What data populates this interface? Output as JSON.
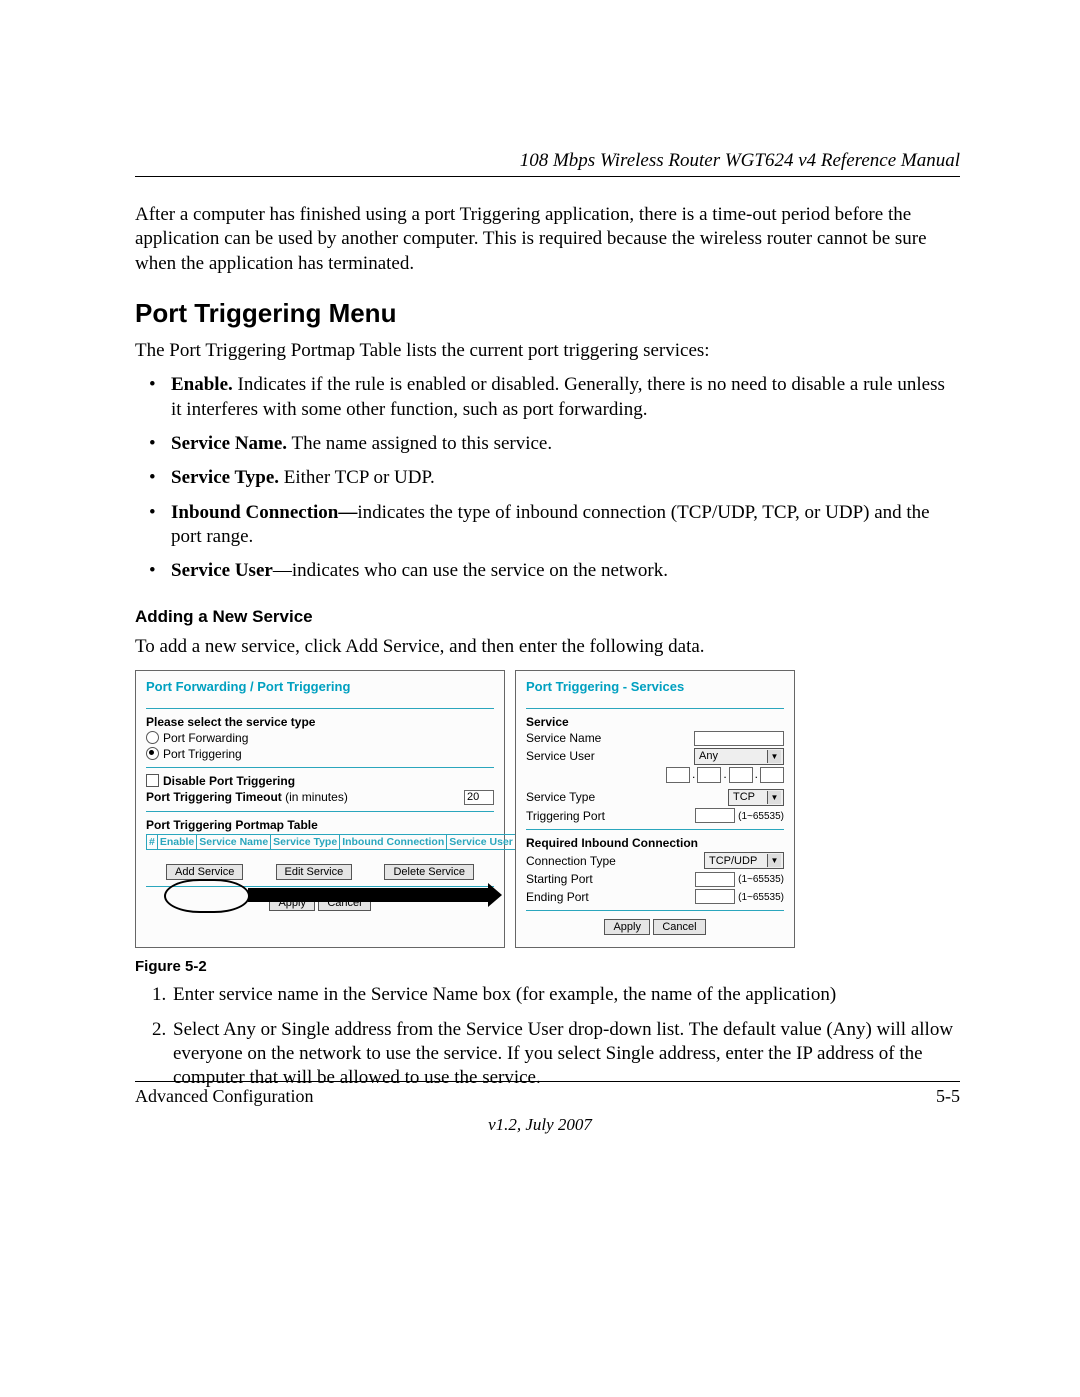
{
  "header": {
    "running_title": "108 Mbps Wireless Router WGT624 v4 Reference Manual"
  },
  "intro_paragraph": "After a computer has finished using a port Triggering application, there is a time-out period before the application can be used by another computer. This is required because the wireless router cannot be sure when the application has terminated.",
  "section": {
    "heading": "Port Triggering Menu",
    "intro": "The Port Triggering Portmap Table lists the current port triggering services:",
    "bullets": {
      "enable_strong": "Enable.",
      "enable_rest": " Indicates if the rule is enabled or disabled. Generally, there is no need to disable a rule unless it interferes with some other function, such as port forwarding.",
      "service_name_strong": "Service Name.",
      "service_name_rest": " The name assigned to this service.",
      "service_type_strong": "Service Type.",
      "service_type_rest": " Either TCP or UDP.",
      "inbound_strong": "Inbound Connection—",
      "inbound_rest": "indicates the type of inbound connection (TCP/UDP, TCP, or UDP) and the port range.",
      "service_user_strong": "Service User",
      "service_user_rest": "—indicates who can use the service on the network."
    }
  },
  "subsection": {
    "heading": "Adding a New Service",
    "intro": "To add a new service, click Add Service, and then enter the following data."
  },
  "left_panel": {
    "title": "Port Forwarding / Port Triggering",
    "select_label": "Please select the service type",
    "radio_forwarding": "Port Forwarding",
    "radio_triggering": "Port Triggering",
    "disable_label": "Disable Port Triggering",
    "timeout_label": "Port Triggering Timeout",
    "timeout_suffix": " (in minutes)",
    "timeout_value": "20",
    "portmap_heading": "Port Triggering Portmap Table",
    "cols": {
      "num": "#",
      "enable": "Enable",
      "sname": "Service Name",
      "stype": "Service Type",
      "inbound": "Inbound Connection",
      "suser": "Service User"
    },
    "btn_add": "Add Service",
    "btn_edit": "Edit Service",
    "btn_delete": "Delete Service",
    "btn_apply": "Apply",
    "btn_cancel": "Cancel"
  },
  "right_panel": {
    "title": "Port Triggering - Services",
    "service_heading": "Service",
    "service_name_label": "Service Name",
    "service_user_label": "Service User",
    "service_user_value": "Any",
    "service_type_label": "Service Type",
    "service_type_value": "TCP",
    "trig_port_label": "Triggering Port",
    "port_range": "(1~65535)",
    "req_heading": "Required Inbound Connection",
    "conn_type_label": "Connection Type",
    "conn_type_value": "TCP/UDP",
    "start_port_label": "Starting Port",
    "end_port_label": "Ending Port",
    "btn_apply": "Apply",
    "btn_cancel": "Cancel"
  },
  "figure_caption": "Figure 5-2",
  "steps": {
    "s1": "Enter service name in the Service Name box (for example, the name of the application)",
    "s2": "Select Any or Single address from the Service User drop-down list. The default value (Any) will allow everyone on the network to use the service. If you select Single address, enter the IP address of the computer that will be allowed to use the service."
  },
  "footer": {
    "section": "Advanced Configuration",
    "page": "5-5",
    "version": "v1.2, July 2007"
  }
}
